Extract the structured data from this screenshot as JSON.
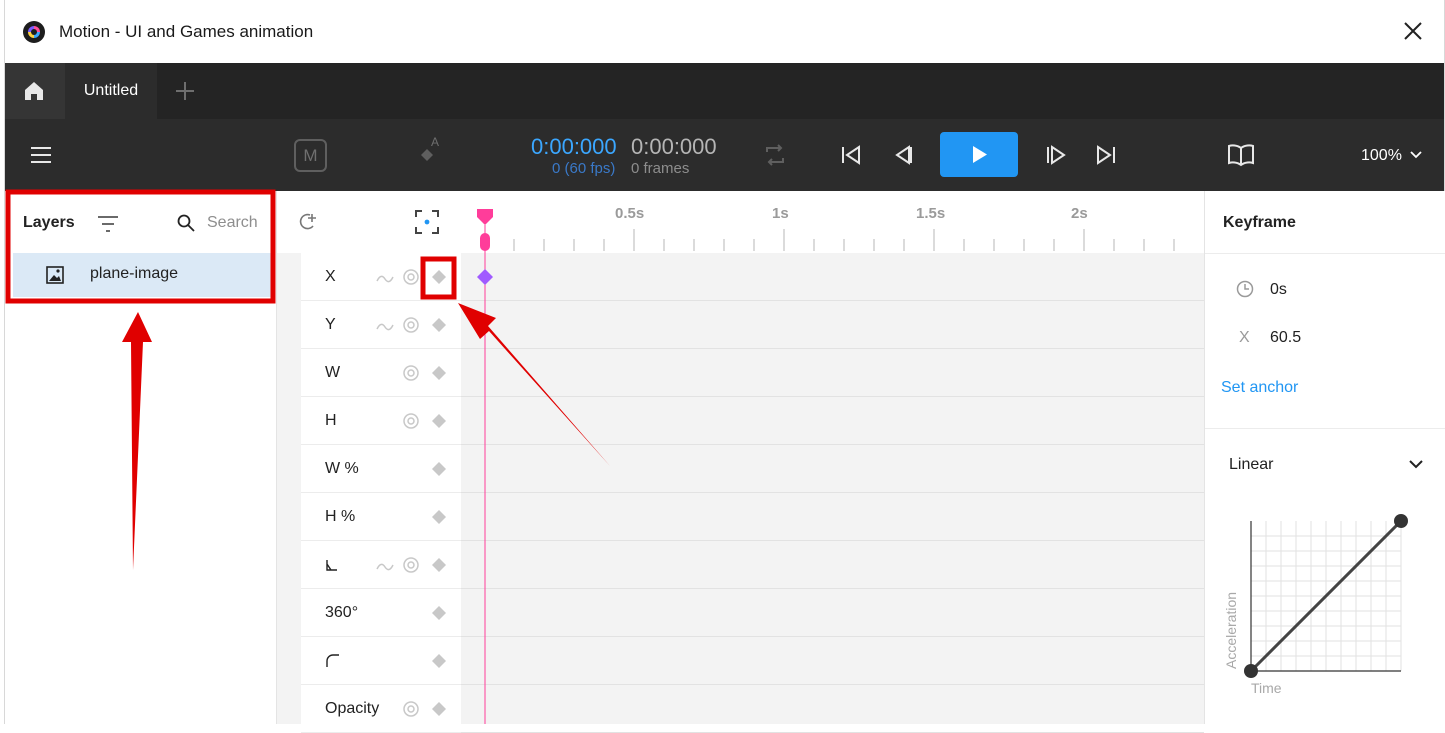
{
  "window": {
    "title": "Motion - UI and Games animation"
  },
  "tabs": {
    "active_label": "Untitled"
  },
  "toolbar": {
    "time_current": "0:00:000",
    "time_total": "0:00:000",
    "fps_text": "0 (60 fps)",
    "frames_text": "0 frames",
    "zoom_label": "100%",
    "m_label": "M",
    "anchor_label": "A"
  },
  "layers": {
    "header": "Layers",
    "search_placeholder": "Search",
    "items": [
      {
        "name": "plane-image"
      }
    ]
  },
  "timeline": {
    "ruler": [
      "0.5s",
      "1s",
      "1.5s",
      "2s"
    ],
    "properties": [
      "X",
      "Y",
      "W",
      "H",
      "W %",
      "H %",
      "",
      "360°",
      "",
      "Opacity"
    ]
  },
  "keyframe_panel": {
    "title": "Keyframe",
    "time_value": "0s",
    "x_label": "X",
    "x_value": "60.5",
    "set_anchor_label": "Set anchor",
    "easing": "Linear",
    "graph_y_label": "Acceleration",
    "graph_x_label": "Time"
  },
  "colors": {
    "accent_blue": "#2196f3",
    "playhead_pink": "#ff3d9a",
    "keyframe_purple": "#a05bff",
    "annotation_red": "#e00000"
  }
}
